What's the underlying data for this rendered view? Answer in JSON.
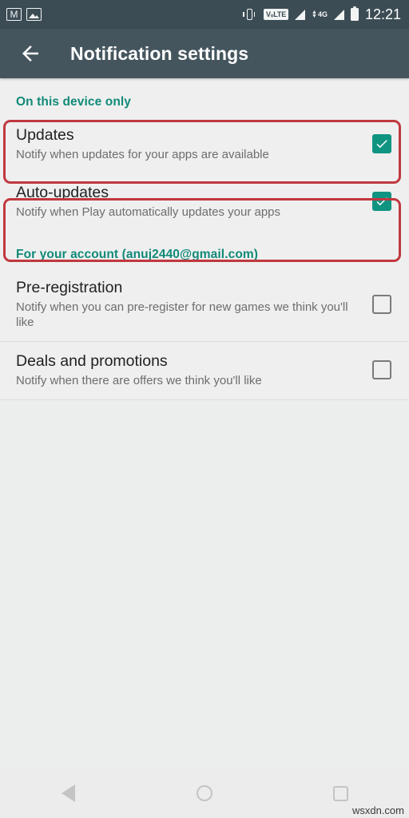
{
  "status_bar": {
    "left_icons": [
      "gmail-icon",
      "photo-icon"
    ],
    "right_icons": [
      "vibrate-icon",
      "volte-badge",
      "signal-icon",
      "data-4g-icon",
      "signal-icon-2",
      "battery-icon"
    ],
    "volte_label": "VₒLTE",
    "network_label": "4G",
    "time": "12:21"
  },
  "app_bar": {
    "back_icon": "back-arrow-icon",
    "title": "Notification settings"
  },
  "sections": [
    {
      "header": "On this device only",
      "rows": [
        {
          "title": "Updates",
          "summary": "Notify when updates for your apps are available",
          "checked": true,
          "annotated": true
        },
        {
          "title": "Auto-updates",
          "summary": "Notify when Play automatically updates your apps",
          "checked": true,
          "annotated": true
        }
      ]
    },
    {
      "header": "For your account (anuj2440@gmail.com)",
      "rows": [
        {
          "title": "Pre-registration",
          "summary": "Notify when you can pre-register for new games we think you'll like",
          "checked": false,
          "annotated": false
        },
        {
          "title": "Deals and promotions",
          "summary": "Notify when there are offers we think you'll like",
          "checked": false,
          "annotated": false
        }
      ]
    }
  ],
  "nav_bar": {
    "back_label": "back-triangle-icon",
    "home_label": "home-circle-icon",
    "recents_label": "recents-square-icon"
  },
  "watermark": "wsxdn.com",
  "colors": {
    "status_bar_bg": "#3c4c55",
    "app_bar_bg": "#44555e",
    "accent_teal": "#108a78",
    "checkbox_on": "#0f9481",
    "annotation_red": "#c0383f",
    "page_bg": "#efefef"
  }
}
